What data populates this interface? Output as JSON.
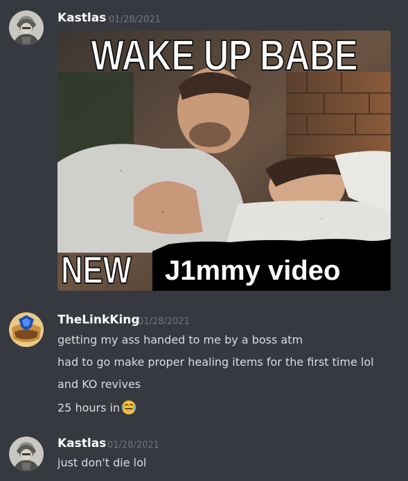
{
  "messages": [
    {
      "author": "Kastlas",
      "timestamp": "01/28/2021",
      "avatar_icon": "soldier-avatar",
      "attachment": {
        "top_text": "WAKE UP BABE",
        "bottom_left_text": "NEW",
        "bottom_right_text": "J1mmy video"
      }
    },
    {
      "author": "TheLinkKing",
      "timestamp": "01/28/2021",
      "avatar_icon": "blue-crest-avatar",
      "lines": [
        "getting my ass handed to me by a boss atm",
        "had to go make proper healing items for the first time lol",
        "and KO revives",
        "25 hours in"
      ],
      "emoji": "joy-emoji"
    },
    {
      "author": "Kastlas",
      "timestamp": "01/28/2021",
      "avatar_icon": "soldier-avatar",
      "lines": [
        "just don't die lol"
      ]
    }
  ],
  "colors": {
    "background": "#36393f",
    "username": "#ffffff",
    "timestamp": "#72767d",
    "text": "#dcddde"
  }
}
